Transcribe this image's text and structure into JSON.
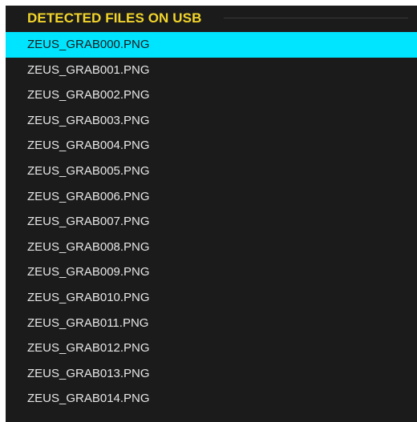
{
  "header": {
    "title": "DETECTED FILES ON USB"
  },
  "file_list": {
    "selected_index": 0,
    "items": [
      "ZEUS_GRAB000.PNG",
      "ZEUS_GRAB001.PNG",
      "ZEUS_GRAB002.PNG",
      "ZEUS_GRAB003.PNG",
      "ZEUS_GRAB004.PNG",
      "ZEUS_GRAB005.PNG",
      "ZEUS_GRAB006.PNG",
      "ZEUS_GRAB007.PNG",
      "ZEUS_GRAB008.PNG",
      "ZEUS_GRAB009.PNG",
      "ZEUS_GRAB010.PNG",
      "ZEUS_GRAB011.PNG",
      "ZEUS_GRAB012.PNG",
      "ZEUS_GRAB013.PNG",
      "ZEUS_GRAB014.PNG"
    ]
  },
  "colors": {
    "background": "#1b1b1b",
    "header_text": "#f2d52b",
    "selection": "#00e5ff",
    "item_text": "#e6e6e6"
  }
}
